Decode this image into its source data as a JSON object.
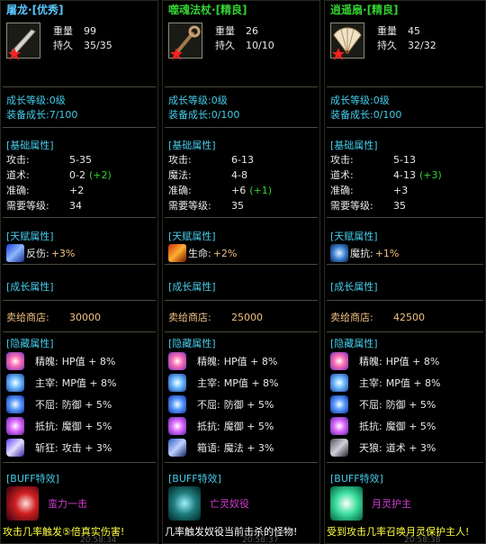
{
  "items": [
    {
      "name": "屠龙",
      "quality": "·[优秀]",
      "name_color": "#5ac8ff",
      "weight_label": "重量",
      "weight": "99",
      "durability_label": "持久",
      "durability": "35/35",
      "icon": "sword-icon",
      "growth_level": "成长等级:0级",
      "equip_growth": "装备成长:7/100",
      "base_title": "[基础属性]",
      "base": [
        {
          "k": "攻击:",
          "v": "5-35",
          "bonus": ""
        },
        {
          "k": "道术:",
          "v": "0-2",
          "bonus": "(+2)"
        },
        {
          "k": "准确:",
          "v": "+2",
          "bonus": ""
        },
        {
          "k": "需要等级:",
          "v": "34",
          "bonus": ""
        }
      ],
      "talent_title": "[天赋属性]",
      "talent_name": "反伤:",
      "talent_value": "+3%",
      "talent_icon": "reflect-icon",
      "growth_title": "[成长属性]",
      "sell_label": "卖给商店:",
      "sell_value": "30000",
      "hidden_title": "[隐藏属性]",
      "hidden": [
        {
          "k": "精魄:",
          "v": "HP值 + 8%",
          "icon": "soul-icon"
        },
        {
          "k": "主宰:",
          "v": "MP值 + 8%",
          "icon": "dominate-icon"
        },
        {
          "k": "不屈:",
          "v": "防御 + 5%",
          "icon": "unyielding-icon"
        },
        {
          "k": "抵抗:",
          "v": "魔御 + 5%",
          "icon": "resist-icon"
        },
        {
          "k": "斩狂:",
          "v": "攻击 + 3%",
          "icon": "slash-icon"
        }
      ],
      "buff_title": "[BUFF特效]",
      "buff_name": "蛮力一击",
      "buff_icon": "brute-strike-icon",
      "footer": "攻击几率触发⑤倍真实伤害!",
      "footer_ghost": "20:58:34"
    },
    {
      "name": "噬魂法杖",
      "quality": "·[精良]",
      "name_color": "#32d232",
      "weight_label": "重量",
      "weight": "26",
      "durability_label": "持久",
      "durability": "10/10",
      "icon": "staff-icon",
      "growth_level": "成长等级:0级",
      "equip_growth": "装备成长:0/100",
      "base_title": "[基础属性]",
      "base": [
        {
          "k": "攻击:",
          "v": "6-13",
          "bonus": ""
        },
        {
          "k": "魔法:",
          "v": "4-8",
          "bonus": ""
        },
        {
          "k": "准确:",
          "v": "+6",
          "bonus": "(+1)"
        },
        {
          "k": "需要等级:",
          "v": "35",
          "bonus": ""
        }
      ],
      "talent_title": "[天赋属性]",
      "talent_name": "生命:",
      "talent_value": "+2%",
      "talent_icon": "life-icon",
      "growth_title": "[成长属性]",
      "sell_label": "卖给商店:",
      "sell_value": "25000",
      "hidden_title": "[隐藏属性]",
      "hidden": [
        {
          "k": "精魄:",
          "v": "HP值 + 8%",
          "icon": "soul-icon"
        },
        {
          "k": "主宰:",
          "v": "MP值 + 8%",
          "icon": "dominate-icon"
        },
        {
          "k": "不屈:",
          "v": "防御 + 5%",
          "icon": "unyielding-icon"
        },
        {
          "k": "抵抗:",
          "v": "魔御 + 5%",
          "icon": "resist-icon"
        },
        {
          "k": "箱语:",
          "v": "魔法 + 3%",
          "icon": "spell-icon"
        }
      ],
      "buff_title": "[BUFF特效]",
      "buff_name": "亡灵奴役",
      "buff_icon": "undead-slave-icon",
      "footer": "几率触发奴役当前击杀的怪物!",
      "footer_ghost": "20:58:37"
    },
    {
      "name": "逍遥扇",
      "quality": "·[精良]",
      "name_color": "#32d232",
      "weight_label": "重量",
      "weight": "45",
      "durability_label": "持久",
      "durability": "32/32",
      "icon": "fan-icon",
      "growth_level": "成长等级:0级",
      "equip_growth": "装备成长:0/100",
      "base_title": "[基础属性]",
      "base": [
        {
          "k": "攻击:",
          "v": "5-13",
          "bonus": ""
        },
        {
          "k": "道术:",
          "v": "4-13",
          "bonus": "(+3)"
        },
        {
          "k": "准确:",
          "v": "+3",
          "bonus": ""
        },
        {
          "k": "需要等级:",
          "v": "35",
          "bonus": ""
        }
      ],
      "talent_title": "[天赋属性]",
      "talent_name": "魔抗:",
      "talent_value": "+1%",
      "talent_icon": "magic-resist-icon",
      "growth_title": "[成长属性]",
      "sell_label": "卖给商店:",
      "sell_value": "42500",
      "hidden_title": "[隐藏属性]",
      "hidden": [
        {
          "k": "精魄:",
          "v": "HP值 + 8%",
          "icon": "soul-icon"
        },
        {
          "k": "主宰:",
          "v": "MP值 + 8%",
          "icon": "dominate-icon"
        },
        {
          "k": "不屈:",
          "v": "防御 + 5%",
          "icon": "unyielding-icon"
        },
        {
          "k": "抵抗:",
          "v": "魔御 + 5%",
          "icon": "resist-icon"
        },
        {
          "k": "天狼:",
          "v": "道术 + 3%",
          "icon": "wolf-icon"
        }
      ],
      "buff_title": "[BUFF特效]",
      "buff_name": "月灵护主",
      "buff_icon": "moon-spirit-icon",
      "footer": "受到攻击几率召唤月灵保护主人!",
      "footer_ghost": "20:58:38"
    }
  ]
}
